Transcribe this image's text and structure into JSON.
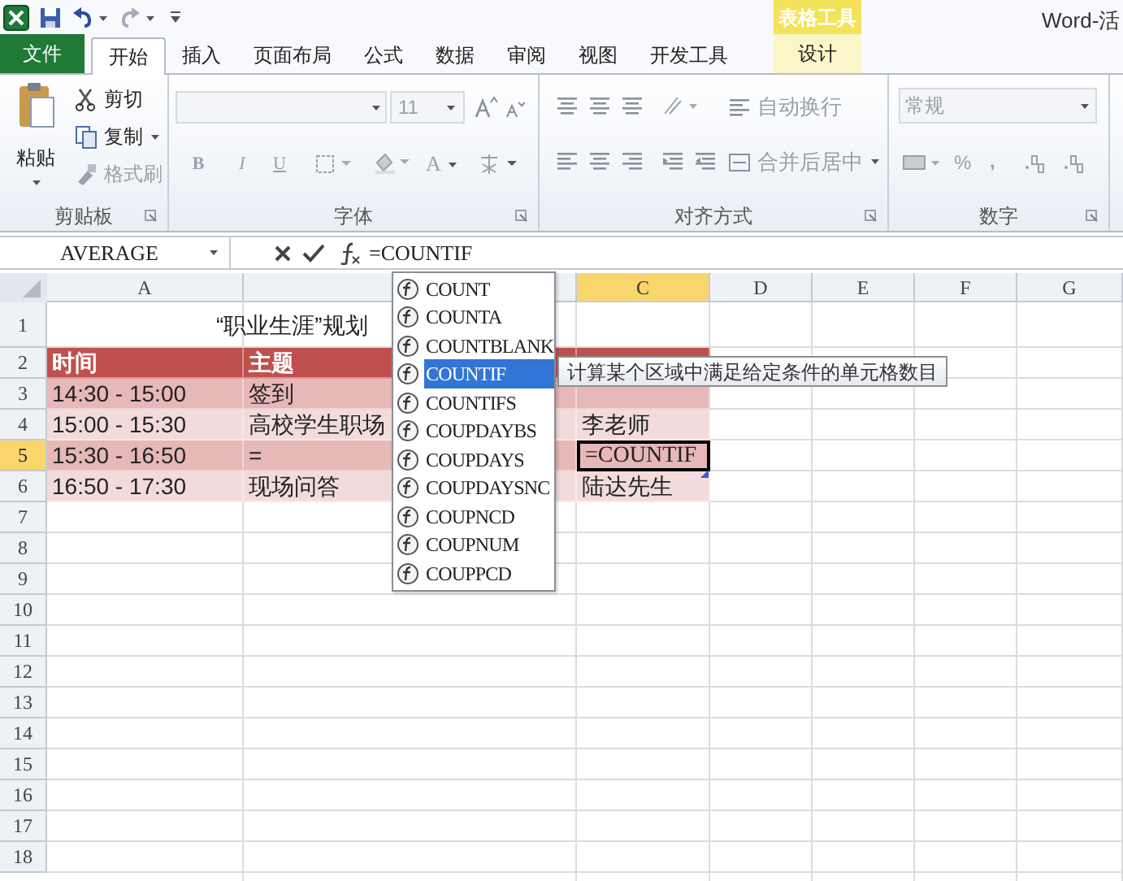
{
  "title_bar": {
    "context_group": "表格工具",
    "title": "Word-活"
  },
  "tabs": [
    {
      "label": "文件",
      "kind": "file",
      "selected": false
    },
    {
      "label": "开始",
      "kind": "normal",
      "selected": true
    },
    {
      "label": "插入",
      "kind": "normal",
      "selected": false
    },
    {
      "label": "页面布局",
      "kind": "normal",
      "selected": false
    },
    {
      "label": "公式",
      "kind": "normal",
      "selected": false
    },
    {
      "label": "数据",
      "kind": "normal",
      "selected": false
    },
    {
      "label": "审阅",
      "kind": "normal",
      "selected": false
    },
    {
      "label": "视图",
      "kind": "normal",
      "selected": false
    },
    {
      "label": "开发工具",
      "kind": "normal",
      "selected": false
    },
    {
      "label": "设计",
      "kind": "contextual",
      "selected": false
    }
  ],
  "ribbon": [
    {
      "kind": "clipboard",
      "label": "剪贴板",
      "paste": "粘贴",
      "items": [
        {
          "label": "剪切",
          "disabled": false,
          "dropdown": false
        },
        {
          "label": "复制",
          "disabled": false,
          "dropdown": true
        },
        {
          "label": "格式刷",
          "disabled": true,
          "dropdown": false
        }
      ]
    },
    {
      "kind": "font",
      "label": "字体",
      "disabled": true,
      "size": "11",
      "bold": "B",
      "italic": "I",
      "underline": "U",
      "font_color": "A"
    },
    {
      "kind": "alignment",
      "label": "对齐方式",
      "disabled": true,
      "wrap": "自动换行",
      "merge": "合并后居中"
    },
    {
      "kind": "number",
      "label": "数字",
      "disabled": true,
      "format": "常规",
      "percent": "%",
      "comma": ","
    }
  ],
  "formula_bar": {
    "name_box": "AVERAGE",
    "formula": "=COUNTIF"
  },
  "sheet": {
    "columns": [
      {
        "label": "A",
        "selected": false
      },
      {
        "selected": false
      },
      {
        "label": "C",
        "selected": true
      },
      {
        "label": "D",
        "selected": false
      },
      {
        "label": "E",
        "selected": false
      },
      {
        "label": "F",
        "selected": false
      },
      {
        "label": "G",
        "selected": false
      }
    ],
    "rows": [
      {
        "number": "1",
        "kind": "title",
        "selected": false,
        "title": "“职业生涯”规划"
      },
      {
        "number": "2",
        "kind": "header",
        "selected": false,
        "cells": [
          "时间",
          "主题"
        ]
      },
      {
        "number": "3",
        "kind": "dark",
        "selected": false,
        "cells": [
          "14:30 - 15:00",
          "签到"
        ]
      },
      {
        "number": "4",
        "kind": "light",
        "selected": false,
        "cells": [
          "15:00 - 15:30",
          "高校学生职场",
          "李老师"
        ]
      },
      {
        "number": "5",
        "kind": "dark",
        "selected": true,
        "cells": [
          "15:30 - 16:50",
          "=",
          "=COUNTIF"
        ]
      },
      {
        "number": "6",
        "kind": "light",
        "selected": false,
        "cells": [
          "16:50 - 17:30",
          "现场问答",
          "陆达先生"
        ]
      },
      {
        "number": "7",
        "kind": "empty",
        "selected": false
      },
      {
        "number": "8",
        "kind": "empty",
        "selected": false
      },
      {
        "number": "9",
        "kind": "empty",
        "selected": false
      },
      {
        "number": "10",
        "kind": "empty",
        "selected": false
      },
      {
        "number": "11",
        "kind": "empty",
        "selected": false
      },
      {
        "number": "12",
        "kind": "empty",
        "selected": false
      },
      {
        "number": "13",
        "kind": "empty",
        "selected": false
      },
      {
        "number": "14",
        "kind": "empty",
        "selected": false
      },
      {
        "number": "15",
        "kind": "empty",
        "selected": false
      },
      {
        "number": "16",
        "kind": "empty",
        "selected": false
      },
      {
        "number": "17",
        "kind": "empty",
        "selected": false
      },
      {
        "number": "18",
        "kind": "empty",
        "selected": false
      }
    ]
  },
  "autocomplete": [
    {
      "label": "COUNT",
      "selected": false
    },
    {
      "label": "COUNTA",
      "selected": false
    },
    {
      "label": "COUNTBLANK",
      "selected": false
    },
    {
      "label": "COUNTIF",
      "selected": true
    },
    {
      "label": "COUNTIFS",
      "selected": false
    },
    {
      "label": "COUPDAYBS",
      "selected": false
    },
    {
      "label": "COUPDAYS",
      "selected": false
    },
    {
      "label": "COUPDAYSNC",
      "selected": false
    },
    {
      "label": "COUPNCD",
      "selected": false
    },
    {
      "label": "COUPNUM",
      "selected": false
    },
    {
      "label": "COUPPCD",
      "selected": false
    }
  ],
  "tooltip": "计算某个区域中满足给定条件的单元格数目"
}
